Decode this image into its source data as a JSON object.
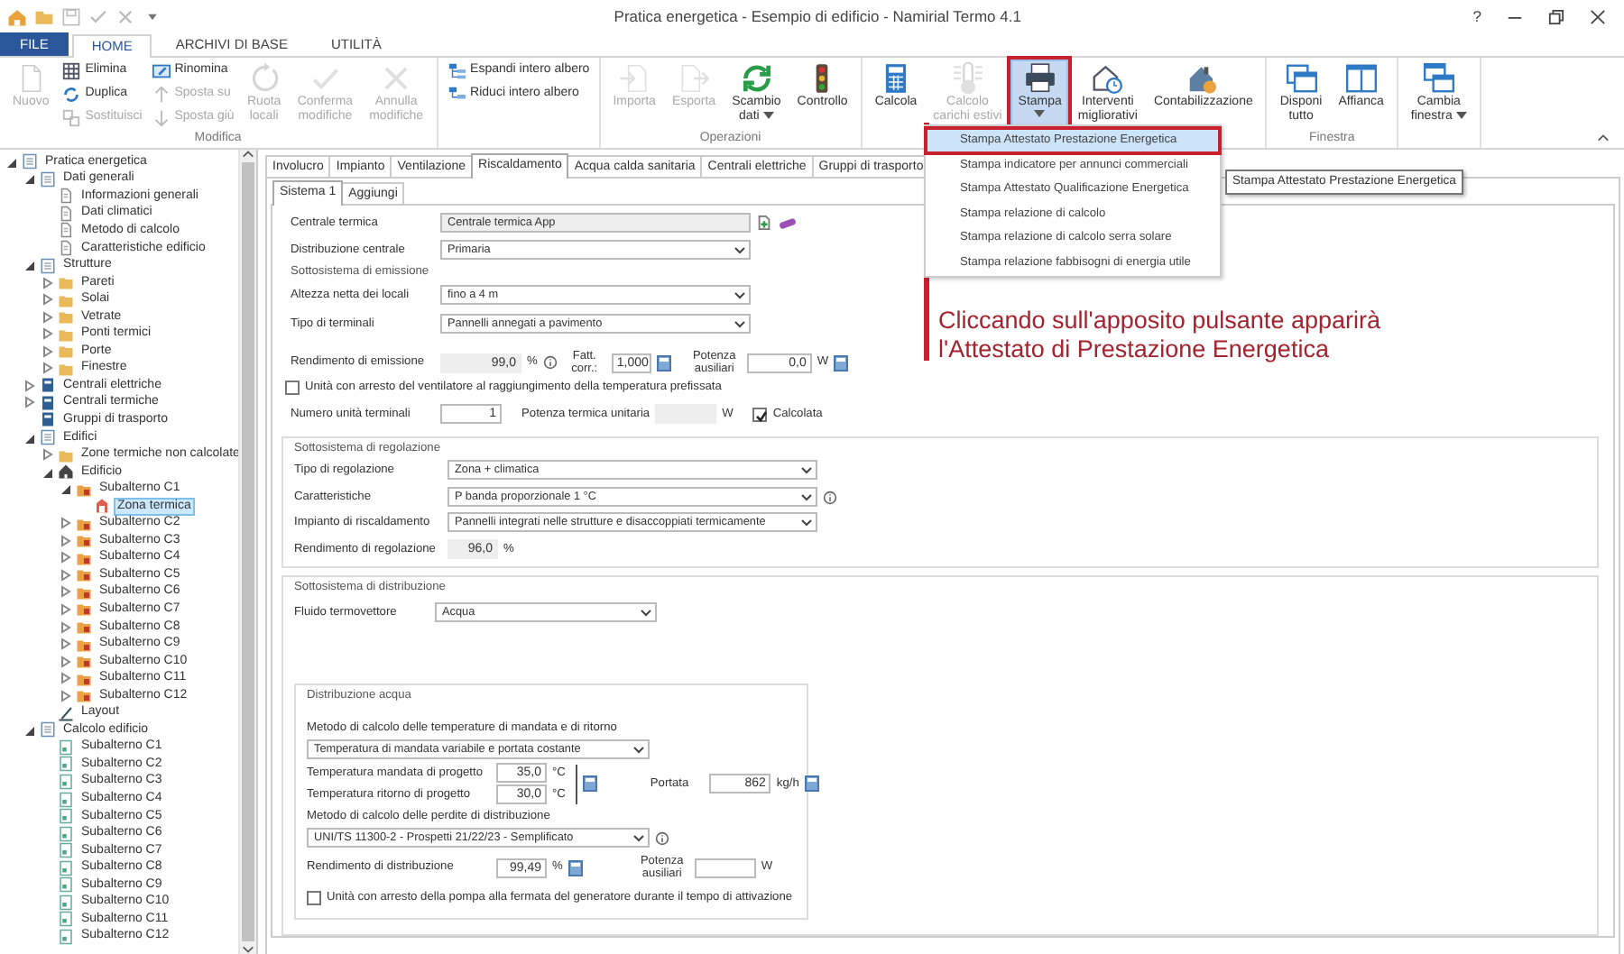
{
  "window": {
    "title": "Pratica energetica - Esempio di edificio - Namirial Termo 4.1",
    "help": "?"
  },
  "ribbon": {
    "tabs": [
      {
        "label": "FILE",
        "kind": "file",
        "selected": false
      },
      {
        "label": "HOME",
        "kind": "tab",
        "selected": true
      },
      {
        "label": "ARCHIVI DI BASE",
        "kind": "tab",
        "selected": false
      },
      {
        "label": "UTILITÀ",
        "kind": "tab",
        "selected": false
      }
    ],
    "groups": [
      {
        "label": "Modifica",
        "items": [
          {
            "kind": "large",
            "label": "Nuovo",
            "disabled": true
          },
          {
            "kind": "stack",
            "buttons": [
              {
                "label": "Elimina",
                "disabled": false
              },
              {
                "label": "Duplica",
                "disabled": false
              },
              {
                "label": "Sostituisci",
                "disabled": true
              }
            ]
          },
          {
            "kind": "stack",
            "buttons": [
              {
                "label": "Rinomina",
                "disabled": false
              },
              {
                "label": "Sposta su",
                "disabled": true
              },
              {
                "label": "Sposta giù",
                "disabled": true
              }
            ]
          },
          {
            "kind": "large",
            "label": "Ruota\nlocali",
            "disabled": true
          },
          {
            "kind": "large",
            "label": "Conferma\nmodifiche",
            "disabled": true
          },
          {
            "kind": "large",
            "label": "Annulla\nmodifiche",
            "disabled": true
          }
        ]
      },
      {
        "items": [
          {
            "kind": "stack",
            "buttons": [
              {
                "label": "Espandi intero albero",
                "disabled": false
              },
              {
                "label": "Riduci intero albero",
                "disabled": false
              }
            ]
          }
        ]
      },
      {
        "label": "Operazioni",
        "items": [
          {
            "kind": "large",
            "label": "Importa",
            "disabled": true
          },
          {
            "kind": "large",
            "label": "Esporta",
            "disabled": true
          },
          {
            "kind": "large",
            "label": "Scambio\ndati",
            "disabled": false,
            "dropdown": true
          },
          {
            "kind": "large",
            "label": "Controllo",
            "disabled": false
          }
        ]
      },
      {
        "items": [
          {
            "kind": "large",
            "label": "Calcola",
            "disabled": false
          },
          {
            "kind": "large",
            "label": "Calcolo\ncarichi estivi",
            "disabled": true
          },
          {
            "kind": "large",
            "label": "Stampa",
            "disabled": false,
            "dropdown": true,
            "pressed": true,
            "annotated": true
          },
          {
            "kind": "large",
            "label": "Interventi\nmigliorativi",
            "disabled": false
          },
          {
            "kind": "large",
            "label": "Contabilizzazione",
            "disabled": false
          }
        ]
      },
      {
        "label": "Finestra",
        "items": [
          {
            "kind": "large",
            "label": "Disponi\ntutto",
            "disabled": false
          },
          {
            "kind": "large",
            "label": "Affianca",
            "disabled": false
          }
        ]
      },
      {
        "items": [
          {
            "kind": "large",
            "label": "Cambia\nfinestra",
            "disabled": false,
            "dropdown": true
          }
        ]
      }
    ]
  },
  "tree": [
    {
      "label": "Pratica energetica",
      "kind": "document",
      "expanded": true,
      "selected": false,
      "children": [
        {
          "label": "Dati generali",
          "kind": "document",
          "expanded": true,
          "selected": false,
          "children": [
            {
              "label": "Informazioni generali",
              "kind": "page",
              "selected": false
            },
            {
              "label": "Dati climatici",
              "kind": "page",
              "selected": false
            },
            {
              "label": "Metodo di calcolo",
              "kind": "page",
              "selected": false
            },
            {
              "label": "Caratteristiche edificio",
              "kind": "page",
              "selected": false
            }
          ]
        },
        {
          "label": "Strutture",
          "kind": "document",
          "expanded": true,
          "selected": false,
          "children": [
            {
              "label": "Pareti",
              "kind": "folder",
              "expanded": false,
              "selected": false
            },
            {
              "label": "Solai",
              "kind": "folder",
              "expanded": false,
              "selected": false
            },
            {
              "label": "Vetrate",
              "kind": "folder",
              "expanded": false,
              "selected": false
            },
            {
              "label": "Ponti termici",
              "kind": "folder",
              "expanded": false,
              "selected": false
            },
            {
              "label": "Porte",
              "kind": "folder",
              "expanded": false,
              "selected": false
            },
            {
              "label": "Finestre",
              "kind": "folder",
              "expanded": false,
              "selected": false
            }
          ]
        },
        {
          "label": "Centrali elettriche",
          "kind": "system",
          "expanded": false,
          "selected": false
        },
        {
          "label": "Centrali termiche",
          "kind": "system",
          "expanded": false,
          "selected": false
        },
        {
          "label": "Gruppi di trasporto",
          "kind": "system",
          "selected": false
        },
        {
          "label": "Edifici",
          "kind": "document",
          "expanded": true,
          "selected": false,
          "children": [
            {
              "label": "Zone termiche non calcolate",
              "kind": "folder",
              "expanded": false,
              "selected": false
            },
            {
              "label": "Edificio",
              "kind": "building",
              "expanded": true,
              "selected": false,
              "children": [
                {
                  "label": "Subalterno C1",
                  "kind": "unit",
                  "expanded": true,
                  "selected": false,
                  "children": [
                    {
                      "label": "Zona termica",
                      "kind": "zone",
                      "selected": true
                    }
                  ]
                },
                {
                  "label": "Subalterno C2",
                  "kind": "unit",
                  "expanded": false,
                  "selected": false
                },
                {
                  "label": "Subalterno C3",
                  "kind": "unit",
                  "expanded": false,
                  "selected": false
                },
                {
                  "label": "Subalterno C4",
                  "kind": "unit",
                  "expanded": false,
                  "selected": false
                },
                {
                  "label": "Subalterno C5",
                  "kind": "unit",
                  "expanded": false,
                  "selected": false
                },
                {
                  "label": "Subalterno C6",
                  "kind": "unit",
                  "expanded": false,
                  "selected": false
                },
                {
                  "label": "Subalterno C7",
                  "kind": "unit",
                  "expanded": false,
                  "selected": false
                },
                {
                  "label": "Subalterno C8",
                  "kind": "unit",
                  "expanded": false,
                  "selected": false
                },
                {
                  "label": "Subalterno C9",
                  "kind": "unit",
                  "expanded": false,
                  "selected": false
                },
                {
                  "label": "Subalterno C10",
                  "kind": "unit",
                  "expanded": false,
                  "selected": false
                },
                {
                  "label": "Subalterno C11",
                  "kind": "unit",
                  "expanded": false,
                  "selected": false
                },
                {
                  "label": "Subalterno C12",
                  "kind": "unit",
                  "expanded": false,
                  "selected": false
                }
              ]
            },
            {
              "label": "Layout",
              "kind": "layout",
              "selected": false
            }
          ]
        },
        {
          "label": "Calcolo edificio",
          "kind": "document",
          "expanded": true,
          "selected": false,
          "children": [
            {
              "label": "Subalterno C1",
              "kind": "sheet",
              "selected": false
            },
            {
              "label": "Subalterno C2",
              "kind": "sheet",
              "selected": false
            },
            {
              "label": "Subalterno C3",
              "kind": "sheet",
              "selected": false
            },
            {
              "label": "Subalterno C4",
              "kind": "sheet",
              "selected": false
            },
            {
              "label": "Subalterno C5",
              "kind": "sheet",
              "selected": false
            },
            {
              "label": "Subalterno C6",
              "kind": "sheet",
              "selected": false
            },
            {
              "label": "Subalterno C7",
              "kind": "sheet",
              "selected": false
            },
            {
              "label": "Subalterno C8",
              "kind": "sheet",
              "selected": false
            },
            {
              "label": "Subalterno C9",
              "kind": "sheet",
              "selected": false
            },
            {
              "label": "Subalterno C10",
              "kind": "sheet",
              "selected": false
            },
            {
              "label": "Subalterno C11",
              "kind": "sheet",
              "selected": false
            },
            {
              "label": "Subalterno C12",
              "kind": "sheet",
              "selected": false
            }
          ]
        }
      ]
    }
  ],
  "tabs": [
    {
      "label": "Involucro",
      "selected": false
    },
    {
      "label": "Impianto",
      "selected": false
    },
    {
      "label": "Ventilazione",
      "selected": false
    },
    {
      "label": "Riscaldamento",
      "selected": true
    },
    {
      "label": "Acqua calda sanitaria",
      "selected": false
    },
    {
      "label": "Centrali elettriche",
      "selected": false
    },
    {
      "label": "Gruppi di trasporto",
      "selected": false
    }
  ],
  "subtabs": [
    {
      "label": "Sistema 1",
      "selected": true
    },
    {
      "label": "Aggiungi",
      "selected": false
    }
  ],
  "heating": {
    "central": {
      "label": "Centrale termica",
      "value": "Centrale termica App"
    },
    "distribution": {
      "label": "Distribuzione centrale",
      "value": "Primaria"
    },
    "emission": {
      "title": "Sottosistema di emissione",
      "height": {
        "label": "Altezza netta dei locali",
        "value": "fino a 4 m"
      },
      "terminals": {
        "label": "Tipo di terminali",
        "value": "Pannelli annegati a pavimento"
      },
      "efficiency": {
        "label": "Rendimento di emissione",
        "value": "99,0",
        "unit": "%"
      },
      "factor": {
        "label": "Fatt. corr.:",
        "value": "1,000"
      },
      "aux_power": {
        "label": "Potenza ausiliari",
        "value": "0,0",
        "unit": "W"
      },
      "fan_stop": {
        "label": "Unità con arresto del ventilatore al raggiungimento della temperatura prefissata",
        "checked": false
      },
      "units": {
        "label": "Numero unità terminali",
        "value": "1"
      },
      "unit_power": {
        "label": "Potenza termica unitaria",
        "unit": "W"
      },
      "calculated": {
        "label": "Calcolata",
        "checked": true
      }
    },
    "regulation": {
      "title": "Sottosistema di regolazione",
      "type": {
        "label": "Tipo di regolazione",
        "value": "Zona + climatica"
      },
      "characteristics": {
        "label": "Caratteristiche",
        "value": "P banda proporzionale 1 °C"
      },
      "system": {
        "label": "Impianto di riscaldamento",
        "value": "Pannelli integrati nelle strutture e disaccoppiati termicamente"
      },
      "efficiency": {
        "label": "Rendimento di regolazione",
        "value": "96,0",
        "unit": "%"
      }
    },
    "distribution_subsystem": {
      "title": "Sottosistema di distribuzione",
      "fluid": {
        "label": "Fluido termovettore",
        "value": "Acqua"
      },
      "water": {
        "title": "Distribuzione acqua",
        "temp_method_label": "Metodo di calcolo delle temperature di mandata e di ritorno",
        "temp_method": "Temperatura di mandata variabile e portata costante",
        "supply": {
          "label": "Temperatura mandata di progetto",
          "value": "35,0",
          "unit": "°C"
        },
        "return": {
          "label": "Temperatura ritorno di progetto",
          "value": "30,0",
          "unit": "°C"
        },
        "flow": {
          "label": "Portata",
          "value": "862",
          "unit": "kg/h"
        },
        "loss_method_label": "Metodo di calcolo delle perdite di distribuzione",
        "loss_method": "UNI/TS 11300-2 - Prospetti 21/22/23 - Semplificato",
        "efficiency": {
          "label": "Rendimento di distribuzione",
          "value": "99,49",
          "unit": "%"
        },
        "aux_power": {
          "label": "Potenza ausiliari",
          "unit": "W"
        },
        "pump_stop": {
          "label": "Unità con arresto della pompa alla fermata del generatore durante il tempo di attivazione",
          "checked": false
        }
      }
    }
  },
  "print_menu": {
    "items": [
      {
        "label": "Stampa Attestato Prestazione Energetica",
        "selected": true,
        "annotated": true
      },
      {
        "label": "Stampa indicatore per annunci commerciali",
        "selected": false
      },
      {
        "label": "Stampa Attestato Qualificazione Energetica",
        "selected": false
      },
      {
        "label": "Stampa relazione di calcolo",
        "selected": false
      },
      {
        "label": "Stampa relazione di calcolo serra solare",
        "selected": false
      },
      {
        "label": "Stampa relazione fabbisogni di energia utile",
        "selected": false
      }
    ]
  },
  "tooltip": {
    "text": "Stampa Attestato Prestazione Energetica"
  },
  "annotation": {
    "text": "Cliccando sull'apposito pulsante apparirà\nl'Attestato di Prestazione Energetica"
  }
}
